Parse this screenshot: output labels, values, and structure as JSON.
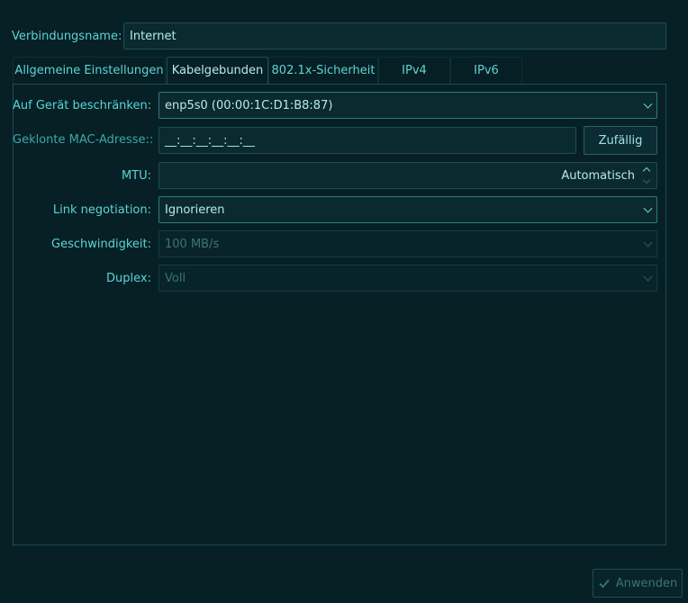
{
  "connection": {
    "name_label": "Verbindungsname:",
    "name_value": "Internet"
  },
  "tabs": [
    {
      "label": "Allgemeine Einstellungen",
      "selected": false
    },
    {
      "label": "Kabelgebunden",
      "selected": true
    },
    {
      "label": "802.1x-Sicherheit",
      "selected": false
    },
    {
      "label": "IPv4",
      "selected": false
    },
    {
      "label": "IPv6",
      "selected": false
    }
  ],
  "wired": {
    "device_label": "Auf Gerät beschränken:",
    "device_value": "enp5s0 (00:00:1C:D1:B8:87)",
    "mac_label": "Geklonte MAC-Adresse::",
    "mac_value": "__:__:__:__:__:__",
    "random_button": "Zufällig",
    "mtu_label": "MTU:",
    "mtu_value": "Automatisch",
    "negotiation_label": "Link negotiation:",
    "negotiation_value": "Ignorieren",
    "speed_label": "Geschwindigkeit:",
    "speed_value": "100 MB/s",
    "duplex_label": "Duplex:",
    "duplex_value": "Voll"
  },
  "footer": {
    "apply_label": "Anwenden"
  },
  "icons": {
    "apply": "checkmark-icon",
    "dropdown": "chevron-down-icon",
    "spin": "spinbox-arrows-icon"
  }
}
